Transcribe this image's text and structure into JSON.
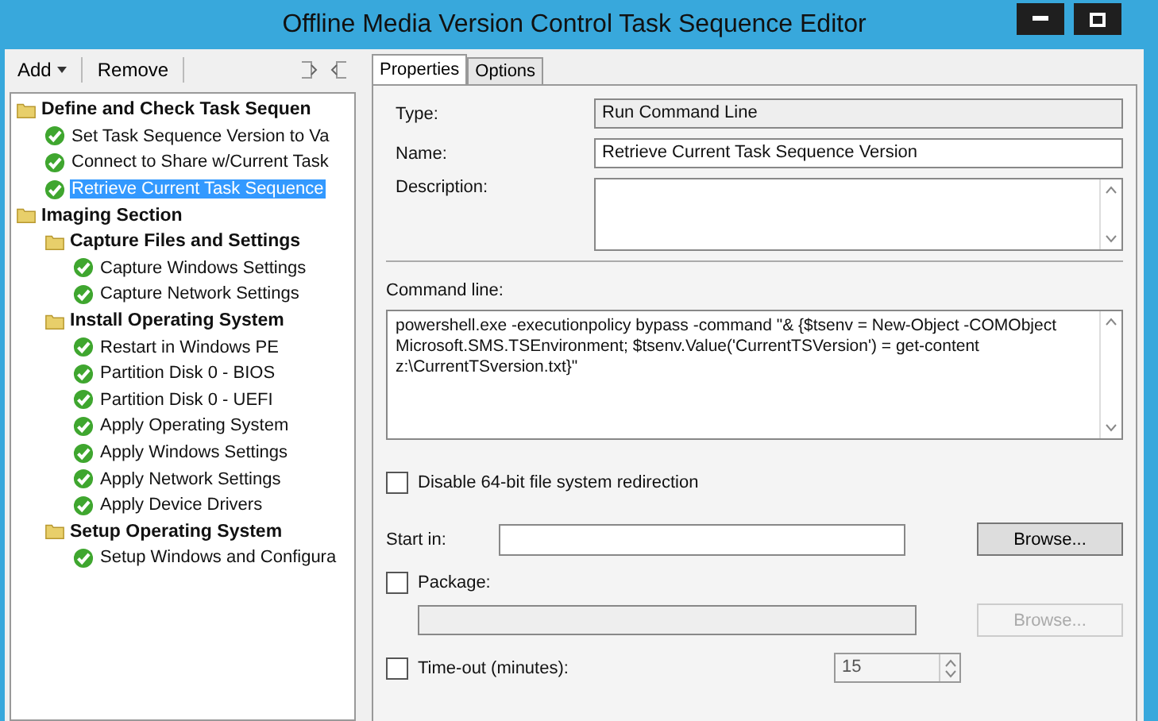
{
  "window": {
    "title": "Offline Media Version Control Task Sequence Editor"
  },
  "toolbar": {
    "add": "Add",
    "remove": "Remove"
  },
  "tree": [
    {
      "kind": "group",
      "label": "Define and Check Task Sequen",
      "children": [
        {
          "kind": "step",
          "label": "Set Task Sequence Version to Va",
          "selected": false
        },
        {
          "kind": "step",
          "label": "Connect to Share w/Current Task",
          "selected": false
        },
        {
          "kind": "step",
          "label": "Retrieve Current Task Sequence",
          "selected": true
        }
      ]
    },
    {
      "kind": "group",
      "label": "Imaging Section",
      "children": [
        {
          "kind": "group",
          "label": "Capture Files and Settings",
          "children": [
            {
              "kind": "step",
              "label": "Capture Windows Settings",
              "selected": false
            },
            {
              "kind": "step",
              "label": "Capture Network Settings",
              "selected": false
            }
          ]
        },
        {
          "kind": "group",
          "label": "Install Operating System",
          "children": [
            {
              "kind": "step",
              "label": "Restart in Windows PE",
              "selected": false
            },
            {
              "kind": "step",
              "label": "Partition Disk 0 - BIOS",
              "selected": false
            },
            {
              "kind": "step",
              "label": "Partition Disk 0 - UEFI",
              "selected": false
            },
            {
              "kind": "step",
              "label": "Apply Operating System",
              "selected": false
            },
            {
              "kind": "step",
              "label": "Apply Windows Settings",
              "selected": false
            },
            {
              "kind": "step",
              "label": "Apply Network Settings",
              "selected": false
            },
            {
              "kind": "step",
              "label": "Apply Device Drivers",
              "selected": false
            }
          ]
        },
        {
          "kind": "group",
          "label": "Setup Operating System",
          "children": [
            {
              "kind": "step",
              "label": "Setup Windows and Configura",
              "selected": false
            }
          ]
        }
      ]
    }
  ],
  "tabs": [
    {
      "label": "Properties",
      "selected": true
    },
    {
      "label": "Options",
      "selected": false
    }
  ],
  "properties": {
    "type_label": "Type:",
    "type_value": "Run Command Line",
    "name_label": "Name:",
    "name_value": "Retrieve Current Task Sequence Version",
    "description_label": "Description:",
    "command_line_label": "Command line:",
    "command_line": "powershell.exe -executionpolicy bypass -command \"& {$tsenv = New-Object -COMObject Microsoft.SMS.TSEnvironment; $tsenv.Value('CurrentTSVersion') = get-content z:\\CurrentTSversion.txt}\"",
    "disable_redirection": {
      "label": "Disable 64-bit file system redirection",
      "checked": false
    },
    "start_in_label": "Start in:",
    "browse": "Browse...",
    "package": {
      "label": "Package:",
      "checked": false
    },
    "package_browse": {
      "label": "Browse...",
      "disabled": true
    },
    "timeout": {
      "label": "Time-out (minutes):",
      "checked": false,
      "value": "15"
    }
  }
}
